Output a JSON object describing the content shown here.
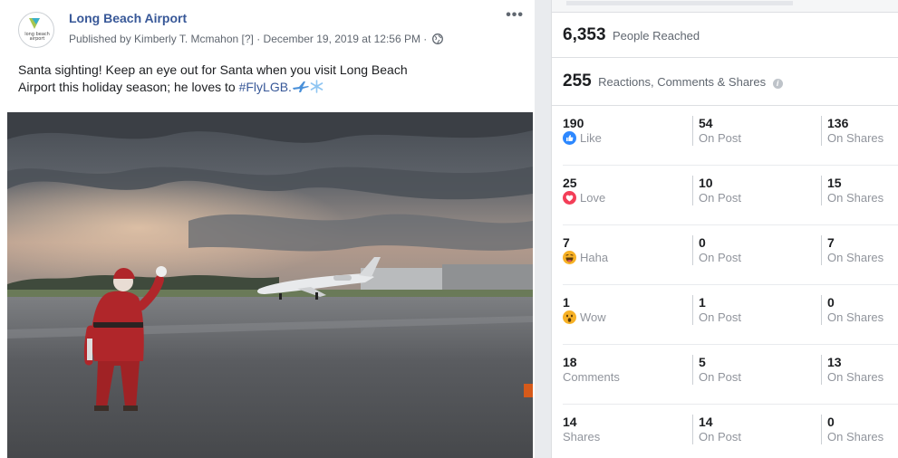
{
  "post": {
    "page_name": "Long Beach Airport",
    "avatar_text": "long beach airport",
    "meta_published": "Published by Kimberly T. Mcmahon [?] · December 19, 2019 at 12:56 PM ·",
    "more_label": "•••",
    "text_line1": "Santa sighting! Keep an eye out for Santa when you visit Long Beach",
    "text_line2_prefix": "Airport this holiday season; he loves to ",
    "hashtag": "#FlyLGB.",
    "photo_icon": "santa-waving-at-airplane-photo"
  },
  "insights": {
    "reach_value": "6,353",
    "reach_label": "People Reached",
    "engagement_value": "255",
    "engagement_label": "Reactions, Comments & Shares",
    "rows": [
      {
        "total": "190",
        "label": "Like",
        "on_post": "54",
        "on_post_label": "On Post",
        "on_shares": "136",
        "on_shares_label": "On Shares",
        "icon": "like-icon"
      },
      {
        "total": "25",
        "label": "Love",
        "on_post": "10",
        "on_post_label": "On Post",
        "on_shares": "15",
        "on_shares_label": "On Shares",
        "icon": "love-icon"
      },
      {
        "total": "7",
        "label": "Haha",
        "on_post": "0",
        "on_post_label": "On Post",
        "on_shares": "7",
        "on_shares_label": "On Shares",
        "icon": "haha-icon"
      },
      {
        "total": "1",
        "label": "Wow",
        "on_post": "1",
        "on_post_label": "On Post",
        "on_shares": "0",
        "on_shares_label": "On Shares",
        "icon": "wow-icon"
      },
      {
        "total": "18",
        "label": "Comments",
        "on_post": "5",
        "on_post_label": "On Post",
        "on_shares": "13",
        "on_shares_label": "On Shares",
        "icon": ""
      },
      {
        "total": "14",
        "label": "Shares",
        "on_post": "14",
        "on_post_label": "On Post",
        "on_shares": "0",
        "on_shares_label": "On Shares",
        "icon": ""
      }
    ]
  },
  "colors": {
    "link": "#385898",
    "like_blue": "#2d88ff",
    "love_red": "#f33e58",
    "haha_yellow": "#f7b125"
  }
}
